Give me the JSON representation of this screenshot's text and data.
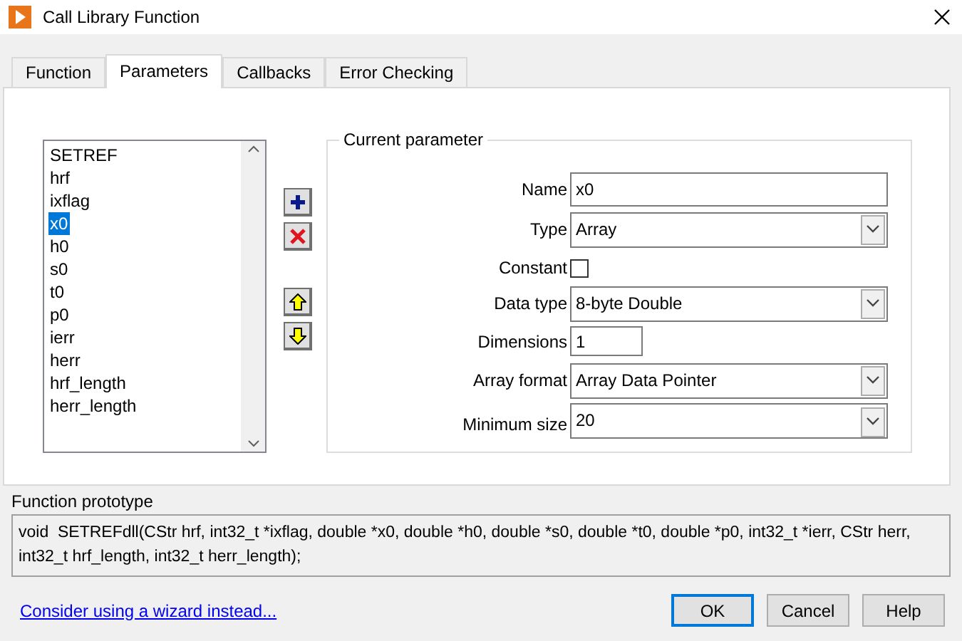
{
  "window": {
    "title": "Call Library Function"
  },
  "tabs": [
    {
      "label": "Function",
      "selected": false
    },
    {
      "label": "Parameters",
      "selected": true
    },
    {
      "label": "Callbacks",
      "selected": false
    },
    {
      "label": "Error Checking",
      "selected": false
    }
  ],
  "parameter_list": [
    {
      "label": "SETREF",
      "selected": false
    },
    {
      "label": "hrf",
      "selected": false
    },
    {
      "label": "ixflag",
      "selected": false
    },
    {
      "label": "x0",
      "selected": true
    },
    {
      "label": "h0",
      "selected": false
    },
    {
      "label": "s0",
      "selected": false
    },
    {
      "label": "t0",
      "selected": false
    },
    {
      "label": "p0",
      "selected": false
    },
    {
      "label": "ierr",
      "selected": false
    },
    {
      "label": "herr",
      "selected": false
    },
    {
      "label": "hrf_length",
      "selected": false
    },
    {
      "label": "herr_length",
      "selected": false
    }
  ],
  "current_parameter": {
    "title": "Current parameter",
    "fields": [
      {
        "kind": "text",
        "label": "Name",
        "value": "x0"
      },
      {
        "kind": "dropdown",
        "label": "Type",
        "value": "Array"
      },
      {
        "kind": "checkbox",
        "label": "Constant",
        "checked": false
      },
      {
        "kind": "dropdown",
        "label": "Data type",
        "value": "8-byte Double"
      },
      {
        "kind": "short_text",
        "label": "Dimensions",
        "value": "1"
      },
      {
        "kind": "dropdown",
        "label": "Array format",
        "value": "Array Data Pointer"
      },
      {
        "kind": "dropdown",
        "label": "Minimum size",
        "value": "20"
      }
    ]
  },
  "prototype": {
    "label": "Function prototype",
    "text": "void  SETREFdll(CStr hrf, int32_t *ixflag, double *x0, double *h0, double *s0, double *t0, double *p0, int32_t *ierr, CStr herr, int32_t hrf_length, int32_t herr_length);"
  },
  "wizard_link": "Consider using a wizard instead...",
  "buttons": [
    {
      "label": "OK",
      "default": true
    },
    {
      "label": "Cancel",
      "default": false
    },
    {
      "label": "Help",
      "default": false
    }
  ]
}
